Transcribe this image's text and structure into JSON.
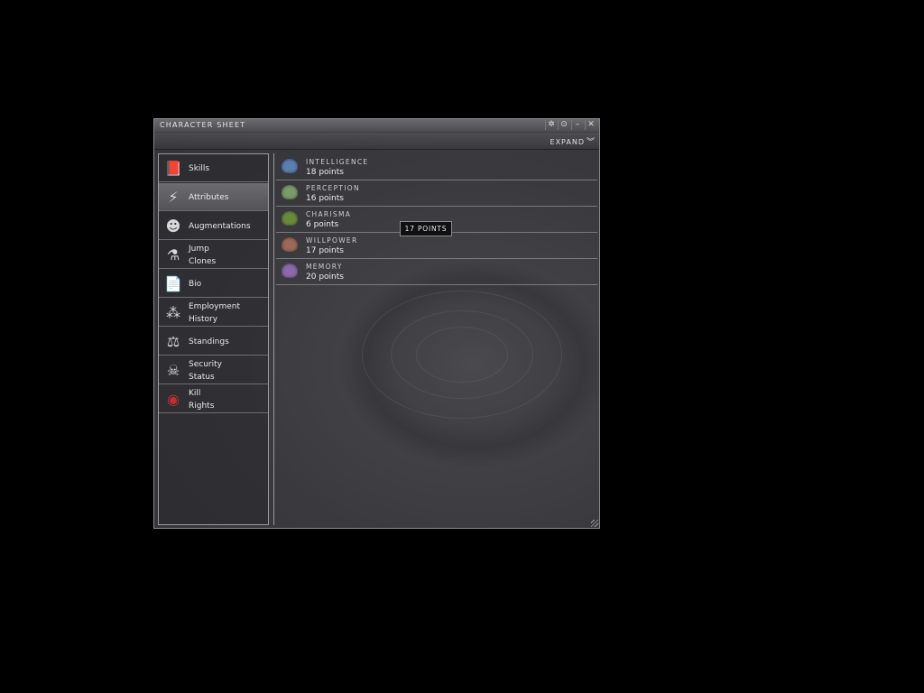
{
  "window": {
    "title": "CHARACTER SHEET",
    "expand_label": "EXPAND",
    "controls": [
      "pin-icon",
      "settings-icon",
      "minimize-icon",
      "close-icon"
    ]
  },
  "sidebar": {
    "items": [
      {
        "label": "Skills",
        "icon": "skills-book-icon",
        "selected": false
      },
      {
        "label": "Attributes",
        "icon": "attributes-icon",
        "selected": true
      },
      {
        "label": "Augmentations",
        "icon": "augmentations-icon",
        "selected": false
      },
      {
        "label": "Jump\nClones",
        "icon": "jump-clones-icon",
        "selected": false
      },
      {
        "label": "Bio",
        "icon": "bio-document-icon",
        "selected": false
      },
      {
        "label": "Employment\nHistory",
        "icon": "employment-history-icon",
        "selected": false
      },
      {
        "label": "Standings",
        "icon": "standings-icon",
        "selected": false
      },
      {
        "label": "Security\nStatus",
        "icon": "security-status-icon",
        "selected": false
      },
      {
        "label": "Kill\nRights",
        "icon": "kill-rights-icon",
        "selected": false
      }
    ]
  },
  "attributes": [
    {
      "name": "INTELLIGENCE",
      "value": "18 points",
      "icon": "intelligence-icon",
      "color": "#5a7fb0"
    },
    {
      "name": "PERCEPTION",
      "value": "16 points",
      "icon": "perception-icon",
      "color": "#7a9a6a"
    },
    {
      "name": "CHARISMA",
      "value": "6 points",
      "icon": "charisma-icon",
      "color": "#6a8a3a"
    },
    {
      "name": "WILLPOWER",
      "value": "17 points",
      "icon": "willpower-icon",
      "color": "#9a6a5a"
    },
    {
      "name": "MEMORY",
      "value": "20 points",
      "icon": "memory-icon",
      "color": "#8a6aa8"
    }
  ],
  "tooltip": {
    "text": "17 POINTS"
  }
}
